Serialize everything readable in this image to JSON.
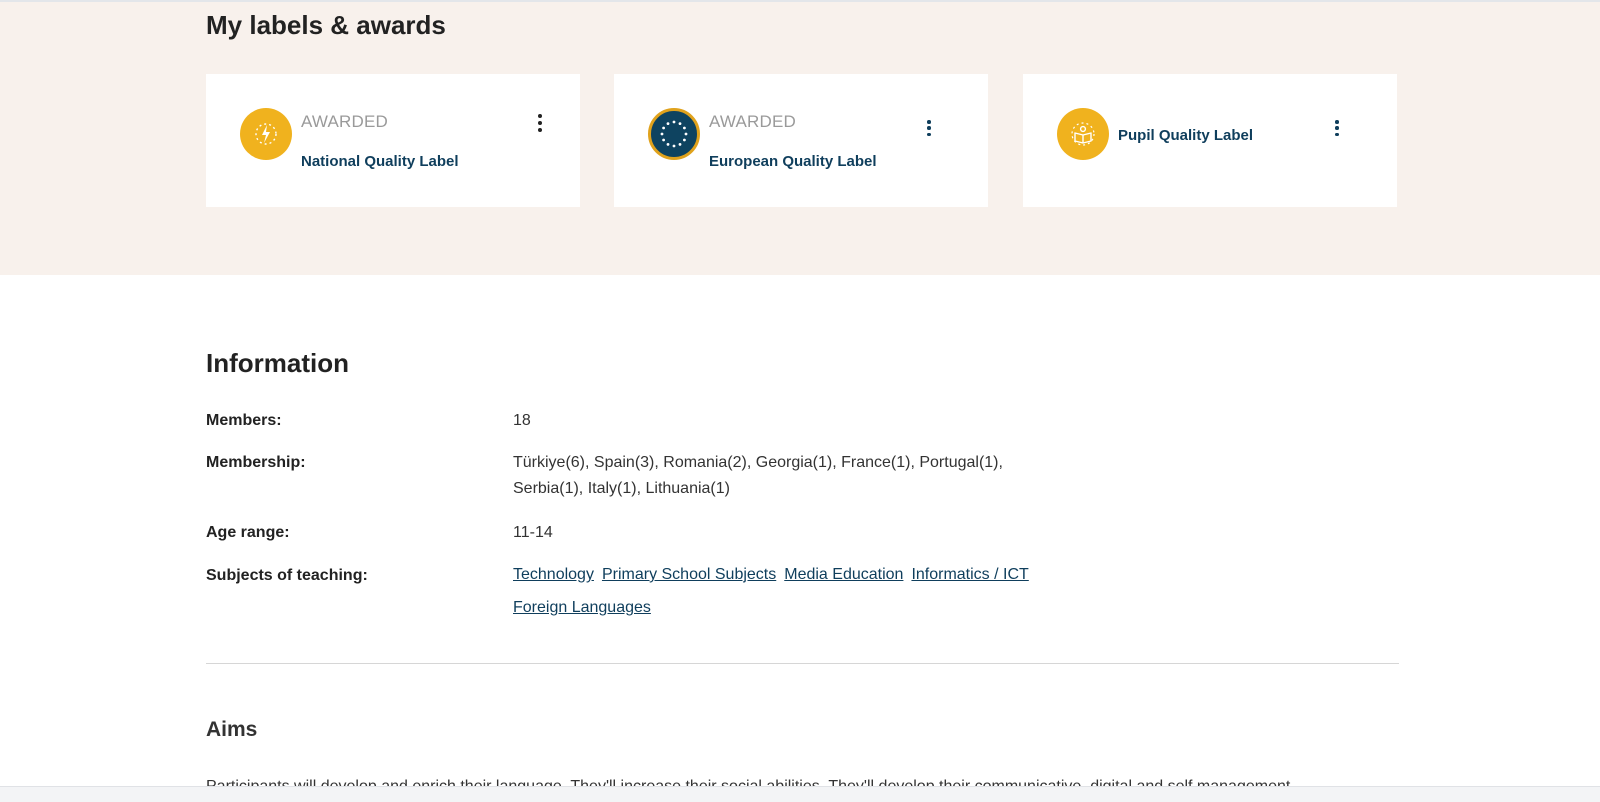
{
  "labels_section": {
    "title": "My labels & awards",
    "cards": [
      {
        "status": "AWARDED",
        "name": "National Quality Label",
        "icon": "national-quality-label-badge-icon"
      },
      {
        "status": "AWARDED",
        "name": "European Quality Label",
        "icon": "european-quality-label-badge-icon"
      },
      {
        "status": "",
        "name": "Pupil Quality Label",
        "icon": "pupil-quality-label-badge-icon"
      }
    ]
  },
  "information": {
    "title": "Information",
    "members_label": "Members:",
    "members_value": "18",
    "membership_label": "Membership:",
    "membership_value": "Türkiye(6), Spain(3), Romania(2), Georgia(1), France(1), Portugal(1), Serbia(1), Italy(1), Lithuania(1)",
    "age_label": "Age range:",
    "age_value": "11-14",
    "subjects_label": "Subjects of teaching:",
    "subjects": [
      "Technology",
      "Primary School Subjects",
      "Media Education",
      "Informatics / ICT",
      "Foreign Languages"
    ]
  },
  "aims": {
    "title": "Aims",
    "text": "Participants will develop and enrich their language. They'll increase their social abilities. They'll develop their communicative, digital and self management"
  },
  "colors": {
    "section_bg": "#f8f1ec",
    "badge_gold": "#f0b21e",
    "brand_navy": "#0f3e5c"
  }
}
